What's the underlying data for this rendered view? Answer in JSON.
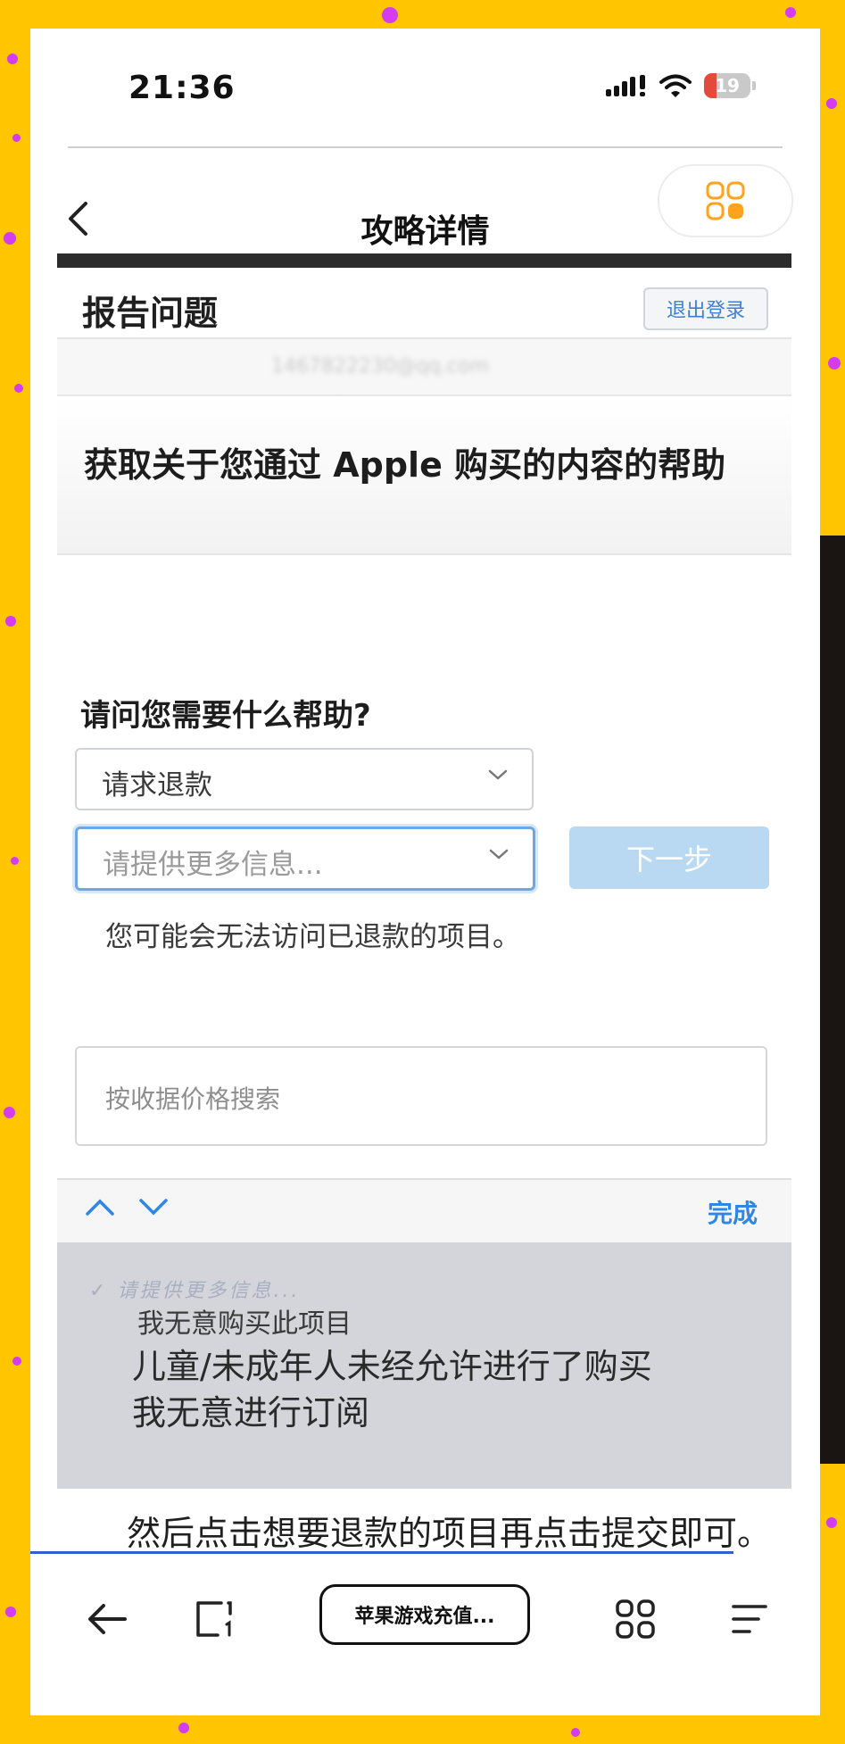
{
  "status_bar": {
    "time": "21:36",
    "battery_level": "19"
  },
  "nav": {
    "title": "攻略详情"
  },
  "embedded_screen": {
    "header_title": "报告问题",
    "logout_button": "退出登录",
    "account_email": "1467822230@qq.com",
    "help_heading": "获取关于您通过 Apple 购买的内容的帮助",
    "question": "请问您需要什么帮助?",
    "select_request": "请求退款",
    "select_more_info_placeholder": "请提供更多信息...",
    "next_button": "下一步",
    "warning": "您可能会无法访问已退款的项目。",
    "search_placeholder": "按收据价格搜索",
    "done_button": "完成",
    "picker": {
      "faded_label": "请提供更多信息...",
      "options": [
        "我无意购买此项目",
        "儿童/未成年人未经允许进行了购买",
        "我无意进行订阅"
      ]
    }
  },
  "caption": "然后点击想要退款的项目再点击提交即可。",
  "bottom_bar": {
    "search_label": "苹果游戏充值..."
  },
  "colors": {
    "background": "#FFC600",
    "dots": "#D33CF0",
    "accent_orange": "#FFA21F",
    "link_blue": "#2E86E6"
  }
}
